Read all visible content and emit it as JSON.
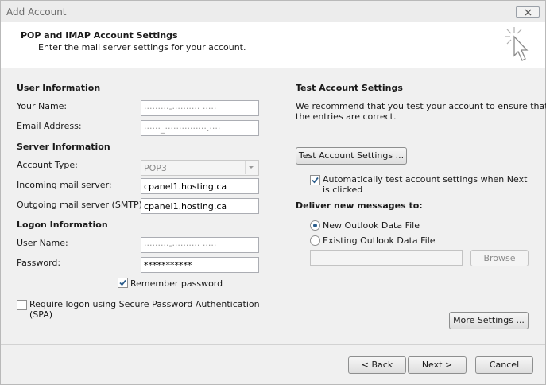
{
  "window": {
    "title": "Add Account"
  },
  "header": {
    "title": "POP and IMAP Account Settings",
    "subtitle": "Enter the mail server settings for your account."
  },
  "user_info": {
    "heading": "User Information",
    "name_label": "Your Name:",
    "name_value": "·········-·········· ·····",
    "email_label": "Email Address:",
    "email_value": "······_···············.····"
  },
  "server_info": {
    "heading": "Server Information",
    "account_type_label": "Account Type:",
    "account_type_value": "POP3",
    "incoming_label": "Incoming mail server:",
    "incoming_value": "cpanel1.hosting.ca",
    "outgoing_label": "Outgoing mail server (SMTP):",
    "outgoing_value": "cpanel1.hosting.ca"
  },
  "logon_info": {
    "heading": "Logon Information",
    "username_label": "User Name:",
    "username_value": "·········-·········· ·····",
    "password_label": "Password:",
    "password_value": "***********",
    "remember_label": "Remember password",
    "remember_checked": true,
    "spa_label_line1": "Require logon using Secure Password Authentication",
    "spa_label_line2": "(SPA)",
    "spa_checked": false
  },
  "test_settings": {
    "heading": "Test Account Settings",
    "description_line1": "We recommend that you test your account to ensure that",
    "description_line2": "the entries are correct.",
    "test_button": "Test Account Settings ...",
    "auto_test_line1": "Automatically test account settings when Next",
    "auto_test_line2": "is clicked",
    "auto_test_checked": true
  },
  "deliver": {
    "heading": "Deliver new messages to:",
    "new_file_label": "New Outlook Data File",
    "existing_file_label": "Existing Outlook Data File",
    "selected": "new",
    "browse_button": "Browse"
  },
  "buttons": {
    "more_settings": "More Settings ...",
    "back": "< Back",
    "next": "Next >",
    "cancel": "Cancel"
  },
  "colors": {
    "dialog_bg": "#f0f0f0",
    "header_bg": "#ffffff",
    "check_color": "#2b5d8c"
  }
}
